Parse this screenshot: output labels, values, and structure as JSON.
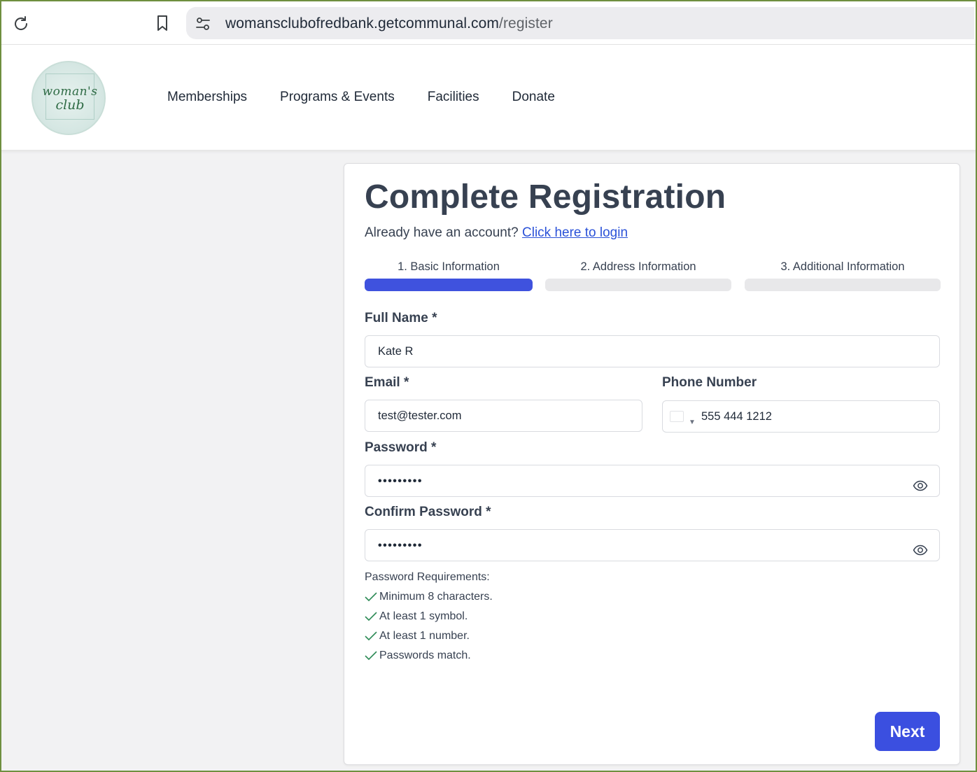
{
  "browser": {
    "url_host": "womansclubofredbank.getcommunal.com",
    "url_path": "/register"
  },
  "header": {
    "logo": {
      "line1": "woman's",
      "line2": "club"
    },
    "nav": [
      {
        "label": "Memberships"
      },
      {
        "label": "Programs & Events"
      },
      {
        "label": "Facilities"
      },
      {
        "label": "Donate"
      }
    ]
  },
  "registration": {
    "title": "Complete Registration",
    "login_prompt": "Already have an account?",
    "login_link": "Click here to login",
    "steps": [
      {
        "label": "1. Basic Information",
        "active": true
      },
      {
        "label": "2. Address Information",
        "active": false
      },
      {
        "label": "3. Additional Information",
        "active": false
      }
    ],
    "fields": {
      "full_name": {
        "label": "Full Name *",
        "value": "Kate R"
      },
      "email": {
        "label": "Email *",
        "value": "test@tester.com"
      },
      "phone": {
        "label": "Phone Number",
        "value": "555 444 1212"
      },
      "password": {
        "label": "Password *",
        "value": "•••••••••"
      },
      "confirm_password": {
        "label": "Confirm Password *",
        "value": "•••••••••"
      }
    },
    "requirements": {
      "title": "Password Requirements:",
      "items": [
        "Minimum 8 characters.",
        "At least 1 symbol.",
        "At least 1 number.",
        "Passwords match."
      ]
    },
    "next_label": "Next"
  },
  "colors": {
    "accent": "#3b4fe0",
    "link": "#2b52d8",
    "check": "#2e8b57",
    "frame": "#6f8f3f"
  },
  "icons": {
    "reload": "reload-icon",
    "bookmark": "bookmark-icon",
    "site_settings": "tune-icon",
    "eye": "eye-icon",
    "check": "checkmark-icon"
  }
}
